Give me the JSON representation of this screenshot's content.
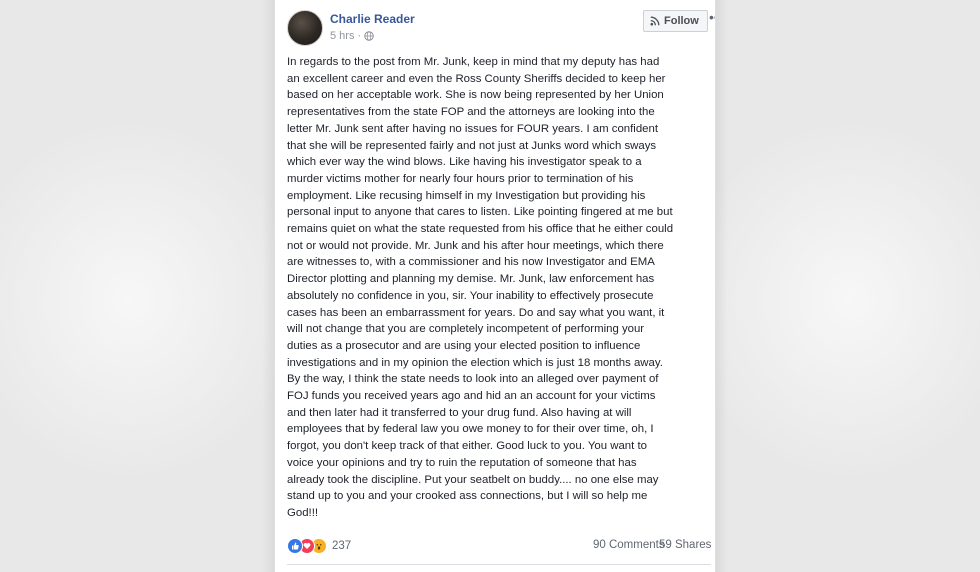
{
  "post": {
    "author": "Charlie Reader",
    "timestamp": "5 hrs",
    "separator": "·",
    "follow_label": "Follow",
    "more_label": "•••",
    "body": "In regards to the post from Mr. Junk, keep in mind that my deputy has had\nan excellent career and even the Ross County Sheriffs decided to keep her\nbased on her acceptable work. She is now being represented by her Union\nrepresentatives from the state FOP and the attorneys are looking into the\nletter Mr. Junk sent after having no issues for FOUR years. I am confident\nthat she will be represented fairly and not just at Junks word which sways\nwhich ever way the wind blows. Like having his investigator speak to a\nmurder victims mother for nearly four hours prior to termination of his\nemployment. Like recusing himself in my Investigation but providing his\npersonal input to anyone that cares to listen. Like pointing fingered at me but\nremains quiet on what the state requested from his office that he either could\nnot or would not provide. Mr. Junk and his after hour meetings, which there\nare witnesses to, with a commissioner and his now Investigator and EMA\nDirector plotting and planning my demise. Mr. Junk, law enforcement has\nabsolutely no confidence in you, sir. Your inability to effectively prosecute\ncases has been an embarrassment for years. Do and say what you want, it\nwill not change that you are completely incompetent of performing your\nduties as a prosecutor and are using your elected position to influence\ninvestigations and in my opinion the election which is just 18 months away.\nBy the way, I think the state needs to look into an alleged over payment of\nFOJ funds you received years ago and hid an an account for your victims\nand then later had it transferred to your drug fund. Also having at will\nemployees that by federal law you owe money to for their over time, oh, I\nforgot, you don't keep track of that either. Good luck to you. You want to\nvoice your opinions and try to ruin the reputation of someone that has\nalready took the discipline. Put your seatbelt on buddy.... no one else may\nstand up to you and your crooked ass connections, but I will so help me\nGod!!!"
  },
  "footer": {
    "reaction_count": "237",
    "comments": "90 Comments",
    "shares": "59 Shares",
    "reaction_icons": [
      "like-icon",
      "love-icon",
      "wow-icon"
    ]
  },
  "colors": {
    "name_link": "#365899",
    "meta_text": "#90949c",
    "body_text": "#1d2129",
    "like": "#3578e5",
    "love": "#f33e58",
    "wow": "#f7b125"
  }
}
